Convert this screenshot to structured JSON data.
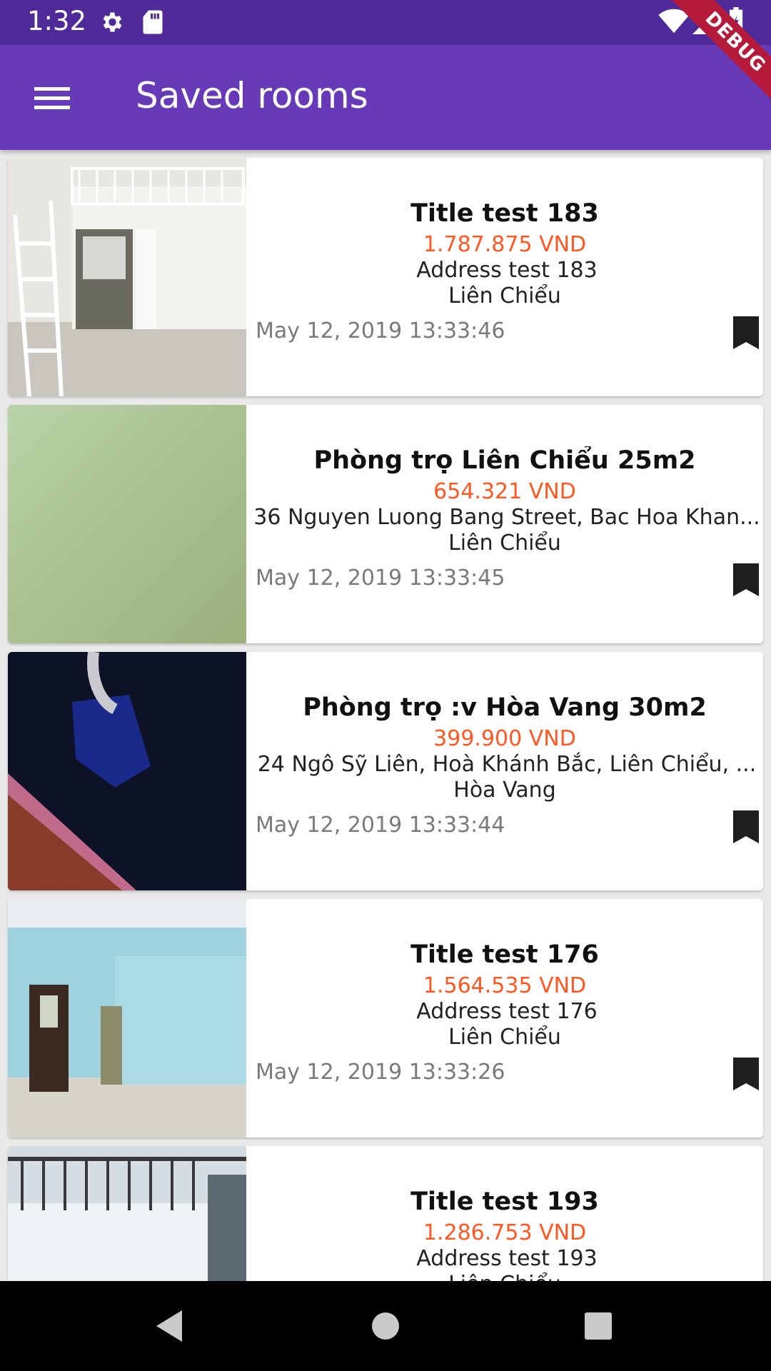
{
  "status_bar": {
    "time": "1:32",
    "icons": [
      "settings-icon",
      "sd-card-icon",
      "wifi-icon",
      "signal-icon",
      "battery-icon"
    ]
  },
  "debug_banner": "DEBUG",
  "app_bar": {
    "title": "Saved rooms",
    "menu_icon": "menu-icon",
    "color": "#673ab7"
  },
  "rooms": [
    {
      "title": "Title test 183",
      "price": "1.787.875 VND",
      "address": "Address test 183",
      "district": "Liên Chiểu",
      "date": "May 12, 2019 13:33:46",
      "bookmarked": true
    },
    {
      "title": "Phòng trọ Liên Chiểu 25m2",
      "price": "654.321 VND",
      "address": "36 Nguyen Luong Bang Street, Bac Hoa Khan...",
      "district": "Liên Chiểu",
      "date": "May 12, 2019 13:33:45",
      "bookmarked": true
    },
    {
      "title": "Phòng trọ :v Hòa Vang 30m2",
      "price": "399.900 VND",
      "address": "24 Ngô Sỹ Liên, Hoà Khánh Bắc, Liên Chiểu, ...",
      "district": "Hòa Vang",
      "date": "May 12, 2019 13:33:44",
      "bookmarked": true
    },
    {
      "title": "Title test 176",
      "price": "1.564.535 VND",
      "address": "Address test 176",
      "district": "Liên Chiểu",
      "date": "May 12, 2019 13:33:26",
      "bookmarked": true
    },
    {
      "title": "Title test 193",
      "price": "1.286.753 VND",
      "address": "Address test 193",
      "district": "Liên Chiểu",
      "date": "",
      "bookmarked": true
    }
  ],
  "colors": {
    "price": "#ff5722",
    "status_bar": "#4f2b9a"
  },
  "nav_bar": {
    "icons": [
      "back-icon",
      "home-icon",
      "recents-icon"
    ]
  }
}
